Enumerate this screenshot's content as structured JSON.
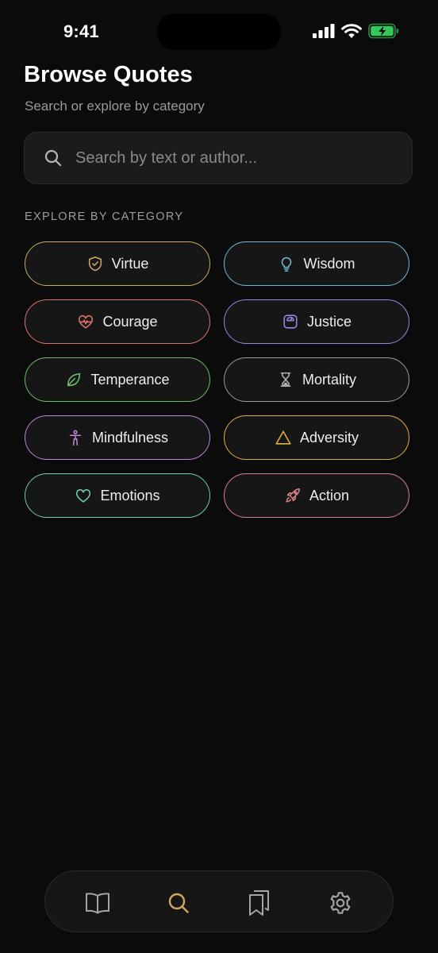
{
  "status_bar": {
    "time": "9:41"
  },
  "header": {
    "title": "Browse Quotes",
    "subtitle": "Search or explore by category"
  },
  "search": {
    "placeholder": "Search by text or author...",
    "value": "",
    "icon": "search-icon"
  },
  "categories_section": {
    "label": "EXPLORE BY CATEGORY",
    "items": [
      {
        "label": "Virtue",
        "icon": "shield-check-icon",
        "color": "#c9a961"
      },
      {
        "label": "Wisdom",
        "icon": "lightbulb-icon",
        "color": "#6fb7d8"
      },
      {
        "label": "Courage",
        "icon": "heart-pulse-icon",
        "color": "#e0736b"
      },
      {
        "label": "Justice",
        "icon": "scale-icon",
        "color": "#9a86e0"
      },
      {
        "label": "Temperance",
        "icon": "leaf-icon",
        "color": "#6cbf6a"
      },
      {
        "label": "Mortality",
        "icon": "hourglass-icon",
        "color": "#9a9a9a"
      },
      {
        "label": "Mindfulness",
        "icon": "person-standing-icon",
        "color": "#c084d8"
      },
      {
        "label": "Adversity",
        "icon": "triangle-icon",
        "color": "#e0b03e"
      },
      {
        "label": "Emotions",
        "icon": "heart-icon",
        "color": "#72c9b4"
      },
      {
        "label": "Action",
        "icon": "rocket-icon",
        "color": "#d6828a"
      }
    ]
  },
  "tab_bar": {
    "tabs": [
      {
        "icon": "book-open-icon",
        "active": false
      },
      {
        "icon": "search-icon",
        "active": true
      },
      {
        "icon": "bookmarks-icon",
        "active": false
      },
      {
        "icon": "settings-gear-icon",
        "active": false
      }
    ],
    "active_color": "#d4a85a",
    "inactive_color": "#a5a5a5"
  }
}
